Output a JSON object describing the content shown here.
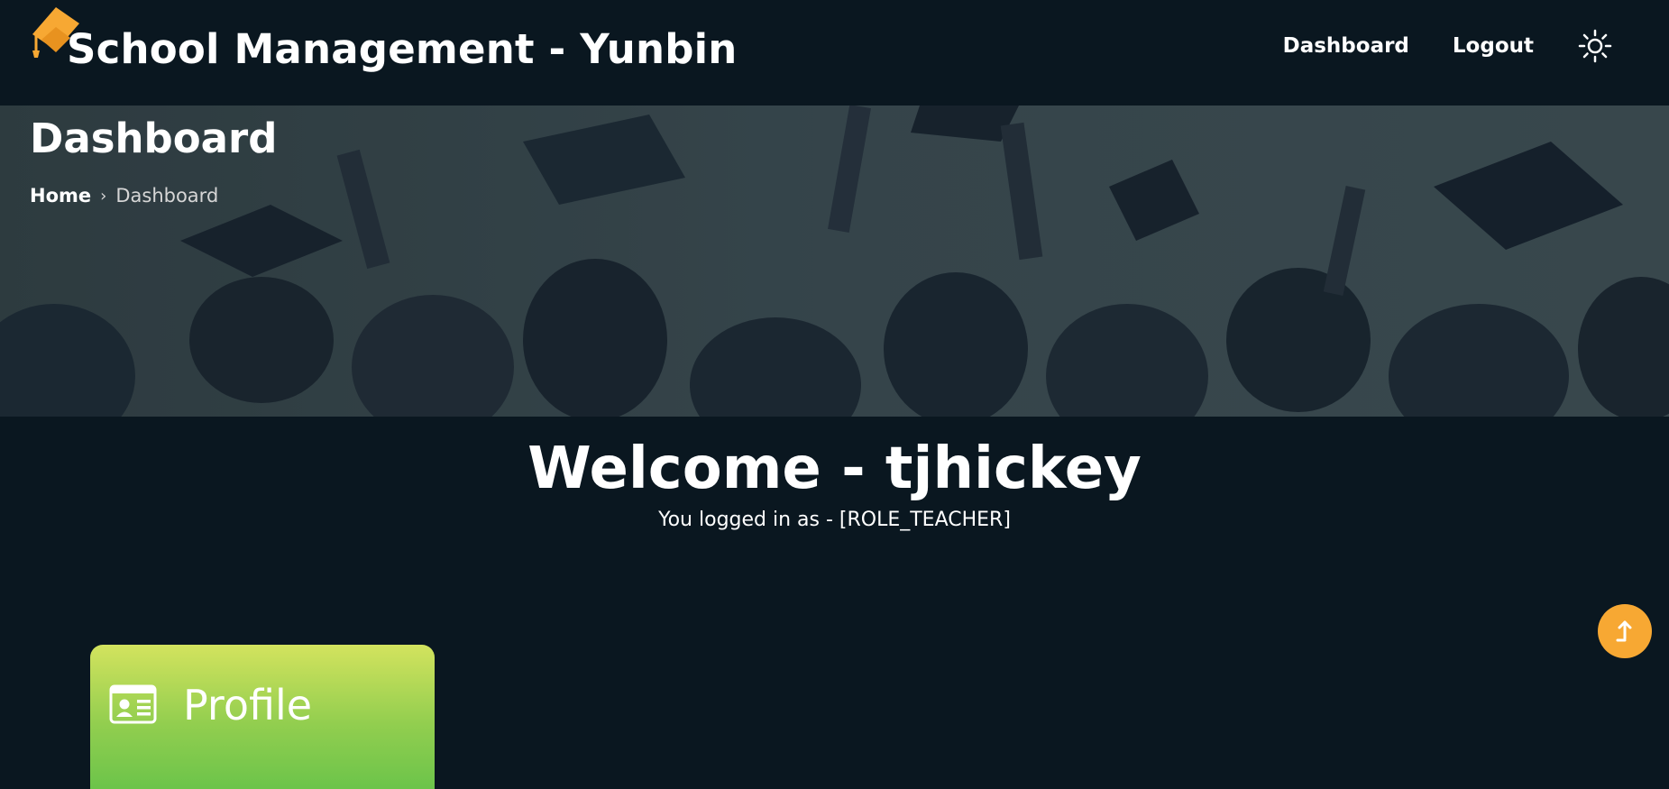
{
  "navbar": {
    "brand_title": "School Management - Yunbin",
    "brand_icon": "graduation-cap-icon",
    "links": [
      {
        "label": "Dashboard"
      },
      {
        "label": "Logout"
      }
    ],
    "theme_toggle_icon": "sun-icon"
  },
  "hero": {
    "title": "Dashboard",
    "breadcrumb": {
      "home": "Home",
      "separator": "›",
      "current": "Dashboard"
    }
  },
  "welcome": {
    "title": "Welcome - tjhickey",
    "subtitle": "You logged in as - [ROLE_TEACHER]"
  },
  "cards": [
    {
      "label": "Profile",
      "icon": "id-card-icon"
    }
  ],
  "scroll_top_icon": "arrow-up-icon",
  "colors": {
    "background": "#0a1720",
    "accent": "#f7a833",
    "card_gradient_top": "#d3e35e",
    "card_gradient_bottom": "#6cc44a"
  }
}
